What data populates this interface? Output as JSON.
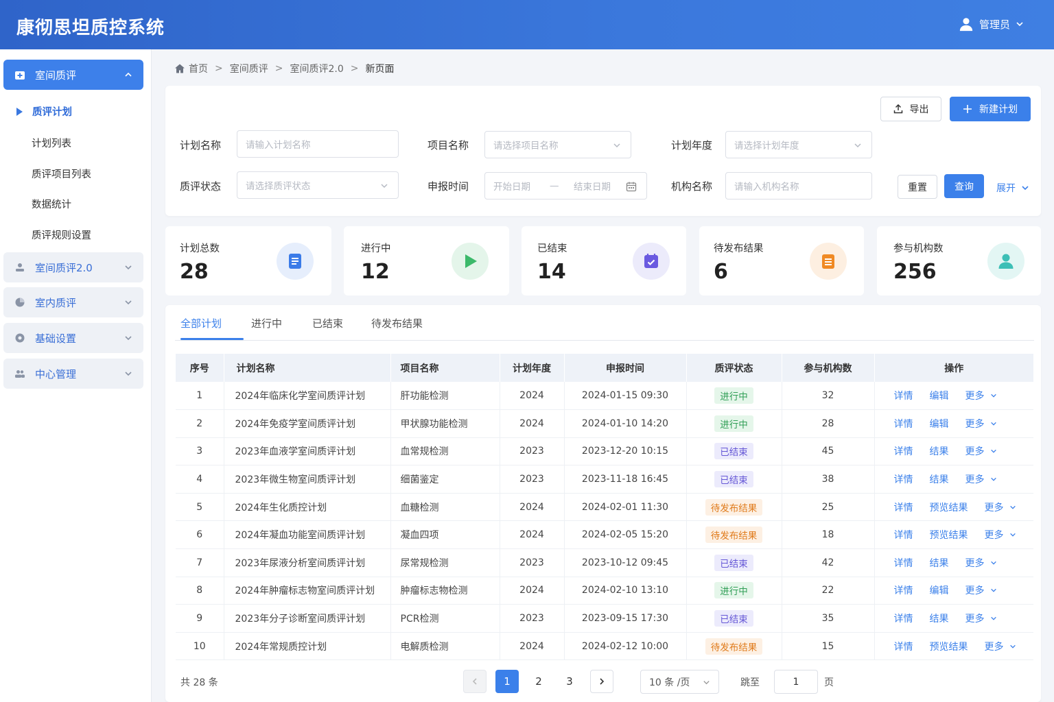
{
  "header": {
    "title": "康彻思坦质控系统",
    "user": "管理员"
  },
  "sidebar": {
    "groups": [
      {
        "label": "室间质评"
      },
      {
        "label": "室间质评2.0"
      },
      {
        "label": "室内质评"
      },
      {
        "label": "基础设置"
      },
      {
        "label": "中心管理"
      }
    ],
    "submenu_title": "质评计划",
    "subitems": [
      "计划列表",
      "质评项目列表",
      "数据统计",
      "质评规则设置"
    ]
  },
  "breadcrumb": [
    "首页",
    "室间质评",
    "室间质评2.0",
    "新页面"
  ],
  "toolbar": {
    "export": "导出",
    "new_plan": "新建计划"
  },
  "filters": {
    "plan_name": {
      "label": "计划名称",
      "placeholder": "请输入计划名称"
    },
    "project_name": {
      "label": "项目名称",
      "placeholder": "请选择项目名称"
    },
    "plan_year": {
      "label": "计划年度",
      "placeholder": "请选择计划年度"
    },
    "status": {
      "label": "质评状态",
      "placeholder": "请选择质评状态"
    },
    "report_time": {
      "label": "申报时间",
      "start": "开始日期",
      "sep": "—",
      "end": "结束日期"
    },
    "org_name": {
      "label": "机构名称",
      "placeholder": "请输入机构名称"
    },
    "reset": "重置",
    "query": "查询",
    "expand": "展开"
  },
  "stats": [
    {
      "label": "计划总数",
      "value": "28",
      "color": "#3b7be8",
      "bg": "#e6eefc"
    },
    {
      "label": "进行中",
      "value": "12",
      "color": "#3cb96a",
      "bg": "#e4f5ea"
    },
    {
      "label": "已结束",
      "value": "14",
      "color": "#6a5ae0",
      "bg": "#ecebfb"
    },
    {
      "label": "待发布结果",
      "value": "6",
      "color": "#f08a24",
      "bg": "#fdefe1"
    },
    {
      "label": "参与机构数",
      "value": "256",
      "color": "#3dbfb6",
      "bg": "#e3f6f4"
    }
  ],
  "tabs": [
    "全部计划",
    "进行中",
    "已结束",
    "待发布结果"
  ],
  "table": {
    "columns": [
      "序号",
      "计划名称",
      "项目名称",
      "计划年度",
      "申报时间",
      "质评状态",
      "参与机构数",
      "操作"
    ],
    "rows": [
      {
        "no": "1",
        "name": "2024年临床化学室间质评计划",
        "project": "肝功能检测",
        "year": "2024",
        "time": "2024-01-15 09:30",
        "status": "进行中",
        "status_type": "running",
        "orgs": "32",
        "ops": [
          "详情",
          "编辑",
          "更多"
        ]
      },
      {
        "no": "2",
        "name": "2024年免疫学室间质评计划",
        "project": "甲状腺功能检测",
        "year": "2024",
        "time": "2024-01-10 14:20",
        "status": "进行中",
        "status_type": "running",
        "orgs": "28",
        "ops": [
          "详情",
          "编辑",
          "更多"
        ]
      },
      {
        "no": "3",
        "name": "2023年血液学室间质评计划",
        "project": "血常规检测",
        "year": "2023",
        "time": "2023-12-20 10:15",
        "status": "已结束",
        "status_type": "ended",
        "orgs": "45",
        "ops": [
          "详情",
          "结果",
          "更多"
        ]
      },
      {
        "no": "4",
        "name": "2023年微生物室间质评计划",
        "project": "细菌鉴定",
        "year": "2023",
        "time": "2023-11-18 16:45",
        "status": "已结束",
        "status_type": "ended",
        "orgs": "38",
        "ops": [
          "详情",
          "结果",
          "更多"
        ]
      },
      {
        "no": "5",
        "name": "2024年生化质控计划",
        "project": "血糖检测",
        "year": "2024",
        "time": "2024-02-01 11:30",
        "status": "待发布结果",
        "status_type": "pending",
        "orgs": "25",
        "ops": [
          "详情",
          "预览结果",
          "更多"
        ]
      },
      {
        "no": "6",
        "name": "2024年凝血功能室间质评计划",
        "project": "凝血四项",
        "year": "2024",
        "time": "2024-02-05 15:20",
        "status": "待发布结果",
        "status_type": "pending",
        "orgs": "18",
        "ops": [
          "详情",
          "预览结果",
          "更多"
        ]
      },
      {
        "no": "7",
        "name": "2023年尿液分析室间质评计划",
        "project": "尿常规检测",
        "year": "2023",
        "time": "2023-10-12 09:45",
        "status": "已结束",
        "status_type": "ended",
        "orgs": "42",
        "ops": [
          "详情",
          "结果",
          "更多"
        ]
      },
      {
        "no": "8",
        "name": "2024年肿瘤标志物室间质评计划",
        "project": "肿瘤标志物检测",
        "year": "2024",
        "time": "2024-02-10 13:10",
        "status": "进行中",
        "status_type": "running",
        "orgs": "22",
        "ops": [
          "详情",
          "编辑",
          "更多"
        ]
      },
      {
        "no": "9",
        "name": "2023年分子诊断室间质评计划",
        "project": "PCR检测",
        "year": "2023",
        "time": "2023-09-15 17:30",
        "status": "已结束",
        "status_type": "ended",
        "orgs": "35",
        "ops": [
          "详情",
          "结果",
          "更多"
        ]
      },
      {
        "no": "10",
        "name": "2024年常规质控计划",
        "project": "电解质检测",
        "year": "2024",
        "time": "2024-02-12 10:00",
        "status": "待发布结果",
        "status_type": "pending",
        "orgs": "15",
        "ops": [
          "详情",
          "预览结果",
          "更多"
        ]
      }
    ]
  },
  "pagination": {
    "total": "共 28 条",
    "pages": [
      "1",
      "2",
      "3"
    ],
    "current": "1",
    "page_size": "10 条 /页",
    "jump_label": "跳至",
    "jump_value": "1",
    "page_unit": "页"
  }
}
